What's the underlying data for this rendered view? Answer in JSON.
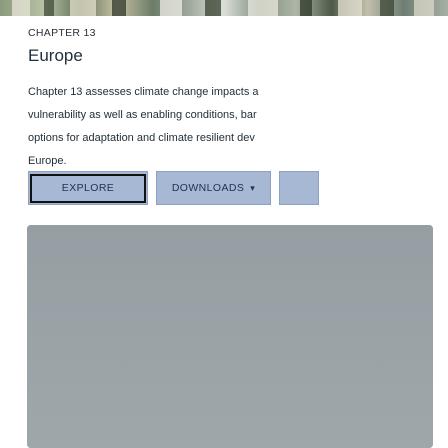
{
  "hero": {
    "image": "landscape-banner"
  },
  "chapter": {
    "label": "CHAPTER 13",
    "title": "Europe",
    "description_lines": [
      "Chapter 13 assesses climate change impacts a",
      "vulnerability as well as enabling conditions, bar",
      "options for adaptation and climate resilient dev",
      "Europe."
    ]
  },
  "buttons": {
    "explore_label": "EXPLORE",
    "downloads_label": "DOWNLOADS",
    "downloads_caret": "▾",
    "more_label": ""
  },
  "colors": {
    "button_bg": "#a7b8d4",
    "preview_bg": "#9aa3a6",
    "text": "#23303a"
  }
}
